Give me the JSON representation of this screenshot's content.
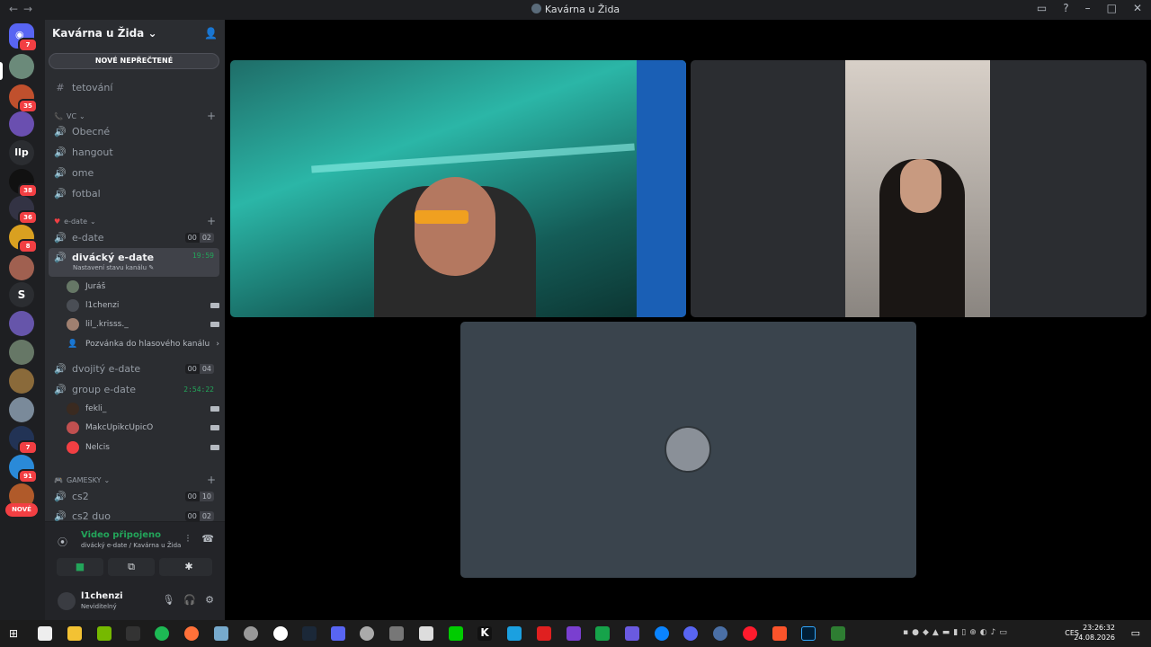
{
  "window": {
    "title": "Kavárna u Žida"
  },
  "servers": {
    "home_badge": "7",
    "items": [
      {
        "badge": "",
        "color": "#6b8a7a"
      },
      {
        "badge": "35",
        "color": "#c0502d"
      },
      {
        "badge": "",
        "color": "#6a4fb0"
      },
      {
        "label": "llp",
        "color": "#2b2d31"
      },
      {
        "badge": "38",
        "color": "#111"
      },
      {
        "badge": "36",
        "color": "#334"
      },
      {
        "badge": "8",
        "color": "#d9a020"
      },
      {
        "badge": "",
        "color": "#a06050"
      },
      {
        "label": "S",
        "color": "#2b2d31"
      },
      {
        "badge": "",
        "color": "#6655aa"
      },
      {
        "badge": "",
        "color": "#667766"
      },
      {
        "badge": "",
        "color": "#8a6a3a"
      },
      {
        "badge": "",
        "color": "#7a8a9a"
      },
      {
        "badge": "7",
        "color": "#223355"
      },
      {
        "badge": "91",
        "color": "#2a8ad8"
      },
      {
        "badge": "",
        "color": "#b05a2a"
      }
    ],
    "new_label": "NOVÉ"
  },
  "guild": {
    "name": "Kavárna u Žida"
  },
  "unread_banner": "NOVÉ NEPŘEČTENÉ",
  "channels": {
    "partial_top": "tetování",
    "vc_category": "VC",
    "vc": [
      "Obecné",
      "hangout",
      "ome",
      "fotbal"
    ],
    "edate_category": "e-date",
    "edate": {
      "name": "e-date",
      "c1": "00",
      "c2": "02"
    },
    "divacky": {
      "name": "divácký e-date",
      "time": "19:59",
      "status": "Nastavení stavu kanálu"
    },
    "divacky_users": [
      "Juráš",
      "l1chenzi",
      "lil_.krisss._"
    ],
    "invite": "Pozvánka do hlasového kanálu",
    "dvojity": {
      "name": "dvojitý e-date",
      "c1": "00",
      "c2": "04"
    },
    "group": {
      "name": "group e-date",
      "time": "2:54:22"
    },
    "group_users": [
      "fekli_",
      "MakcUpikcUpicO",
      "Nelcis"
    ],
    "gamesky_category": "GAMESKY",
    "cs2": {
      "name": "cs2",
      "c1": "00",
      "c2": "10"
    },
    "cs2duo": {
      "name": "cs2 duo",
      "c1": "00",
      "c2": "02"
    }
  },
  "voice": {
    "title": "Video připojeno",
    "sub": "divácký e-date / Kavárna u Žida"
  },
  "user": {
    "name": "l1chenzi",
    "status": "Neviditelný"
  },
  "taskbar": {
    "lang": "CES",
    "time": "23:26:32",
    "date": "24.08.2026"
  }
}
